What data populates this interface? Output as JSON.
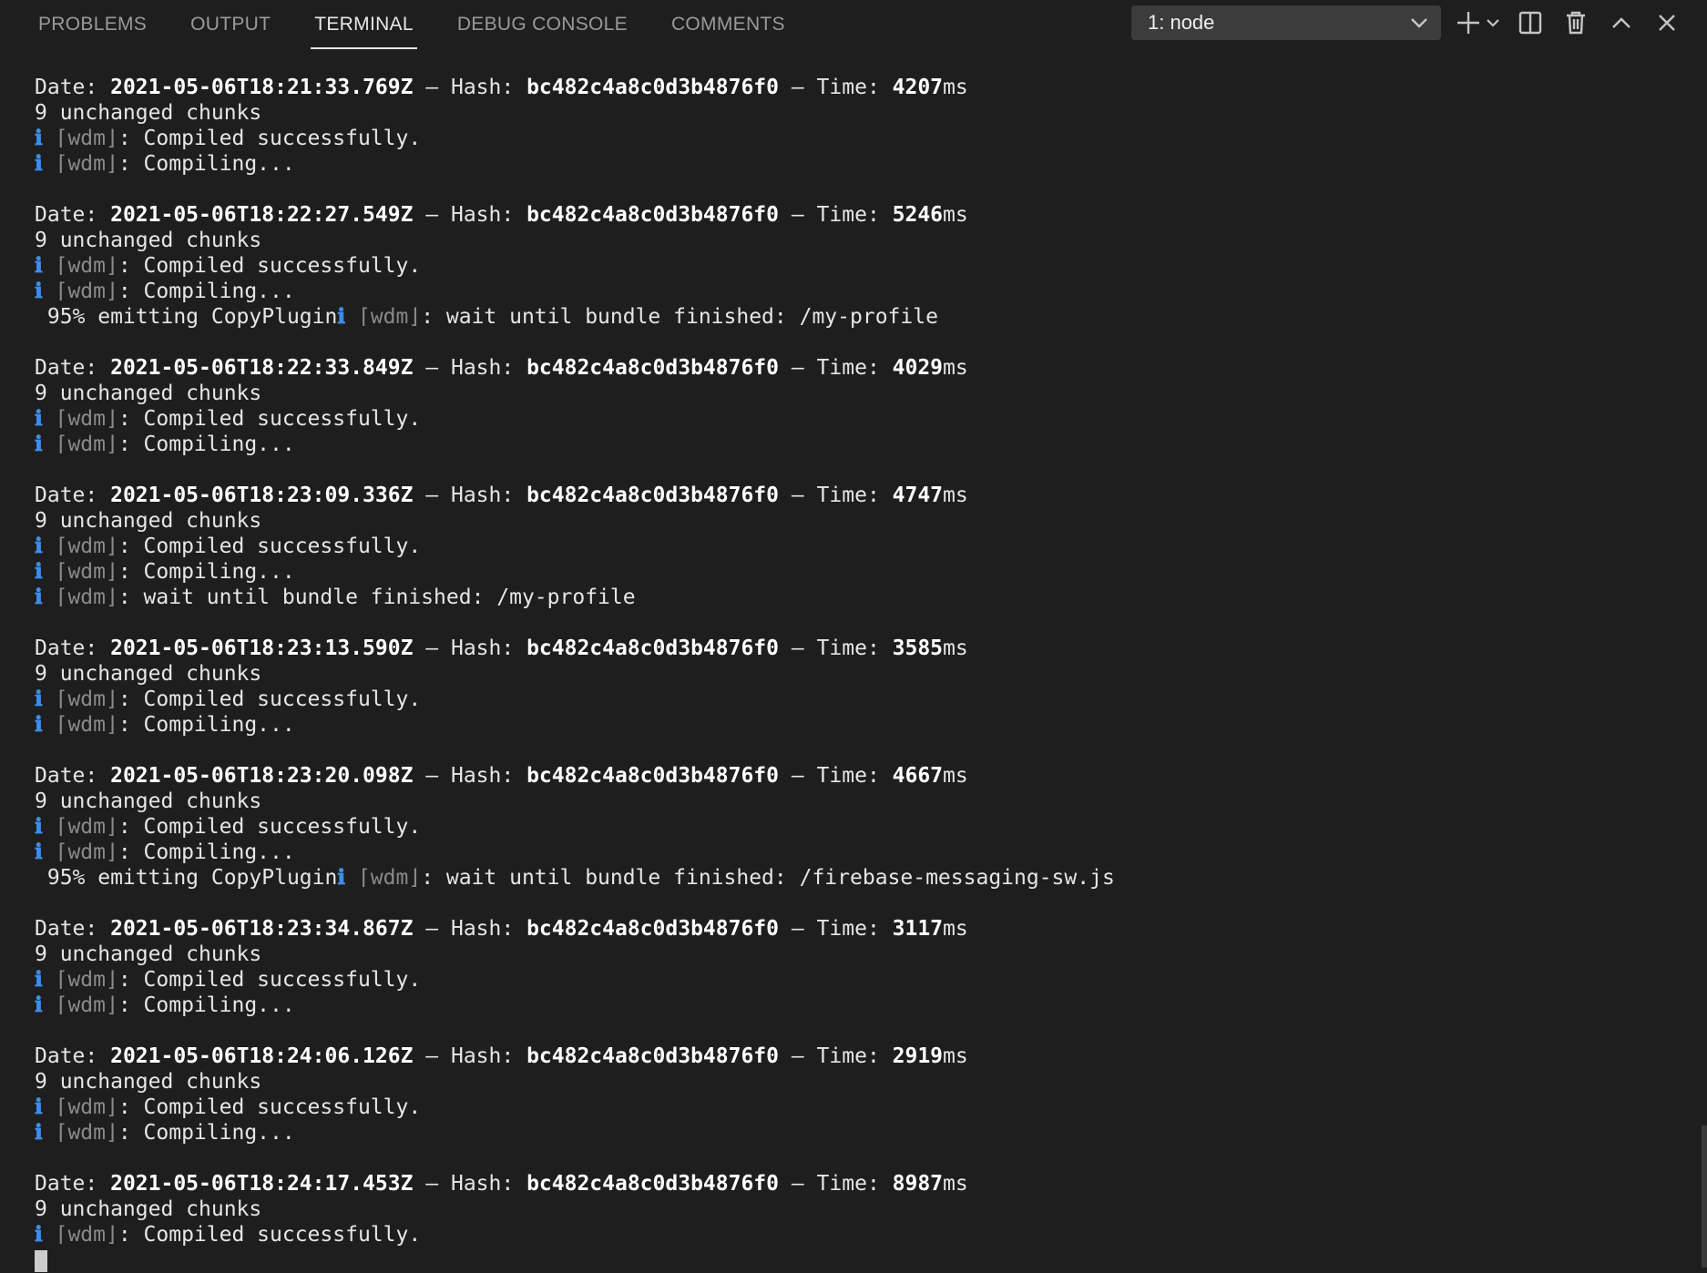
{
  "tabs": [
    {
      "label": "PROBLEMS"
    },
    {
      "label": "OUTPUT"
    },
    {
      "label": "TERMINAL"
    },
    {
      "label": "DEBUG CONSOLE"
    },
    {
      "label": "COMMENTS"
    }
  ],
  "active_tab": "TERMINAL",
  "terminal_select": {
    "value": "1: node"
  },
  "toolbar_icons": [
    "plus-icon",
    "chevron-down-icon",
    "split-icon",
    "trash-icon",
    "chevron-up-icon",
    "close-icon"
  ],
  "strings": {
    "date_prefix": "Date: ",
    "hash_sep": " – Hash: ",
    "time_sep": " – Time: ",
    "ms": "ms",
    "info": "ℹ",
    "wdm": " ⌈wdm⌋",
    "compiled": ": Compiled successfully.",
    "compiling": ": Compiling...",
    "wait_prefix": ": wait until bundle finished: ",
    "emitting": " 95% emitting CopyPlugin"
  },
  "entries": [
    {
      "date": "2021-05-06T18:21:33.769Z",
      "hash": "bc482c4a8c0d3b4876f0",
      "time": "4207",
      "chunks": "9 unchanged chunks",
      "extra": null
    },
    {
      "date": "2021-05-06T18:22:27.549Z",
      "hash": "bc482c4a8c0d3b4876f0",
      "time": "5246",
      "chunks": "9 unchanged chunks",
      "extra": {
        "type": "emit",
        "path": "/my-profile"
      }
    },
    {
      "date": "2021-05-06T18:22:33.849Z",
      "hash": "bc482c4a8c0d3b4876f0",
      "time": "4029",
      "chunks": "9 unchanged chunks",
      "extra": null
    },
    {
      "date": "2021-05-06T18:23:09.336Z",
      "hash": "bc482c4a8c0d3b4876f0",
      "time": "4747",
      "chunks": "9 unchanged chunks",
      "extra": {
        "type": "wait",
        "path": "/my-profile"
      }
    },
    {
      "date": "2021-05-06T18:23:13.590Z",
      "hash": "bc482c4a8c0d3b4876f0",
      "time": "3585",
      "chunks": "9 unchanged chunks",
      "extra": null
    },
    {
      "date": "2021-05-06T18:23:20.098Z",
      "hash": "bc482c4a8c0d3b4876f0",
      "time": "4667",
      "chunks": "9 unchanged chunks",
      "extra": {
        "type": "emit",
        "path": "/firebase-messaging-sw.js"
      }
    },
    {
      "date": "2021-05-06T18:23:34.867Z",
      "hash": "bc482c4a8c0d3b4876f0",
      "time": "3117",
      "chunks": "9 unchanged chunks",
      "extra": null
    },
    {
      "date": "2021-05-06T18:24:06.126Z",
      "hash": "bc482c4a8c0d3b4876f0",
      "time": "2919",
      "chunks": "9 unchanged chunks",
      "extra": null
    },
    {
      "date": "2021-05-06T18:24:17.453Z",
      "hash": "bc482c4a8c0d3b4876f0",
      "time": "8987",
      "chunks": "9 unchanged chunks",
      "extra": null,
      "last": true
    }
  ]
}
